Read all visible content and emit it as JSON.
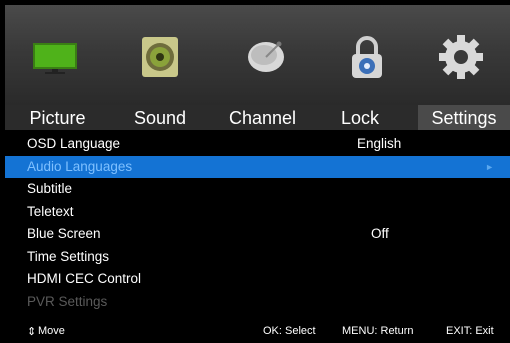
{
  "icons": [
    {
      "name": "tv-picture-icon",
      "active": true
    },
    {
      "name": "speaker-sound-icon",
      "active": false
    },
    {
      "name": "satellite-dish-channel-icon",
      "active": false
    },
    {
      "name": "padlock-lock-icon",
      "active": false
    },
    {
      "name": "gear-settings-icon",
      "active": false
    }
  ],
  "tabs": [
    {
      "label": "Picture",
      "active": false
    },
    {
      "label": "Sound",
      "active": false
    },
    {
      "label": "Channel",
      "active": false
    },
    {
      "label": "Lock",
      "active": false
    },
    {
      "label": "Settings",
      "active": true
    }
  ],
  "menu": [
    {
      "label": "OSD Language",
      "value": "English",
      "state": "normal"
    },
    {
      "label": "Audio Languages",
      "value": "",
      "state": "highlight",
      "chevron": "►"
    },
    {
      "label": "Subtitle",
      "value": "",
      "state": "normal"
    },
    {
      "label": "Teletext",
      "value": "",
      "state": "normal"
    },
    {
      "label": "Blue Screen",
      "value": "Off",
      "state": "normal"
    },
    {
      "label": "Time Settings",
      "value": "",
      "state": "normal"
    },
    {
      "label": "HDMI CEC Control",
      "value": "",
      "state": "normal"
    },
    {
      "label": "PVR Settings",
      "value": "",
      "state": "disabled"
    }
  ],
  "footer": {
    "move_icon": "⇕",
    "move": "Move",
    "ok": "OK: Select",
    "menu": "MENU: Return",
    "exit": "EXIT: Exit"
  },
  "colors": {
    "highlight": "#1473d4",
    "active_tab": "#4a4a4a",
    "tab_bar": "#2b2b2b",
    "disabled_text": "#5a5a5a"
  }
}
